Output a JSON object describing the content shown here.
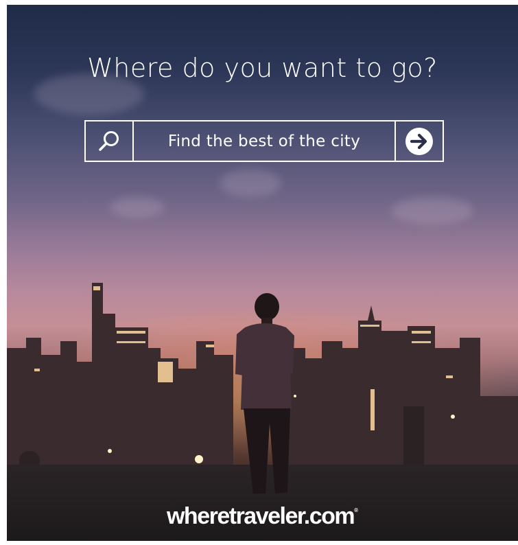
{
  "headline": "Where do you want to go?",
  "search": {
    "placeholder": "Find the best of the city",
    "search_icon": "search-icon",
    "submit_icon": "arrow-right-circle-icon"
  },
  "brand": {
    "name": "wheretraveler.com",
    "registered": "®"
  }
}
